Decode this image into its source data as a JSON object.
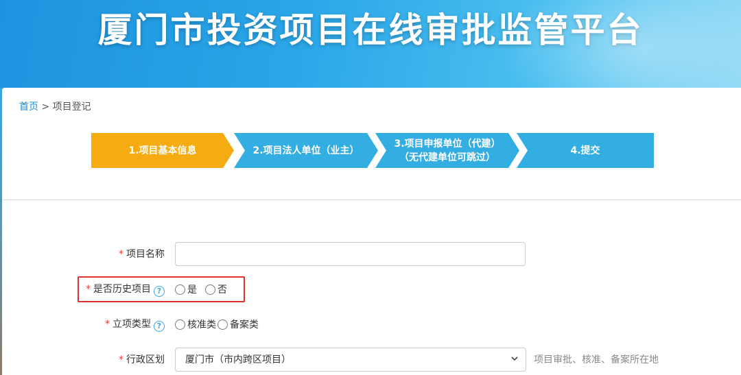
{
  "header": {
    "title": "厦门市投资项目在线审批监管平台"
  },
  "breadcrumb": {
    "home": "首页",
    "separator": ">",
    "current": "项目登记"
  },
  "steps": [
    {
      "label": "1.项目基本信息",
      "active": true
    },
    {
      "label": "2.项目法人单位（业主）",
      "active": false
    },
    {
      "label_line1": "3.项目申报单位（代建）",
      "label_line2": "（无代建单位可跳过）",
      "active": false
    },
    {
      "label": "4.提交",
      "active": false
    }
  ],
  "form": {
    "required_mark": "*",
    "help_glyph": "?",
    "project_name": {
      "label": "项目名称",
      "value": ""
    },
    "historical": {
      "label": "是否历史项目",
      "options": [
        "是",
        "否"
      ]
    },
    "approval_type": {
      "label": "立项类型",
      "options": [
        "核准类",
        "备案类"
      ]
    },
    "district": {
      "label": "行政区划",
      "selected": "厦门市（市内跨区项目）",
      "hint": "项目审批、核准、备案所在地"
    }
  },
  "colors": {
    "active_step": "#f5ac12",
    "inactive_step": "#32aee3",
    "highlight": "#e0302d",
    "link": "#1a8fd8"
  }
}
